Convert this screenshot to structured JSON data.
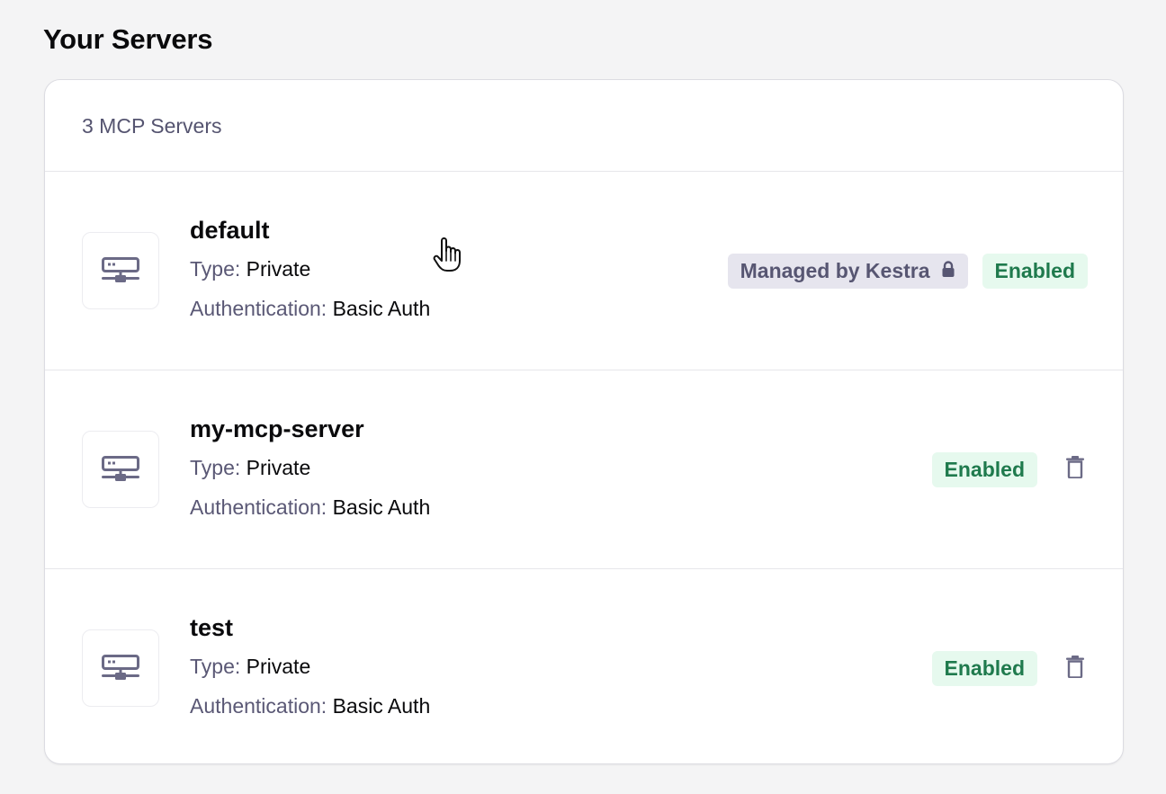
{
  "page": {
    "title": "Your Servers"
  },
  "servers_card": {
    "count_label": "3 MCP Servers"
  },
  "servers": [
    {
      "name": "default",
      "type_label": "Type:",
      "type_value": "Private",
      "auth_label": "Authentication:",
      "auth_value": "Basic Auth",
      "managed_label": "Managed by Kestra",
      "status": "Enabled"
    },
    {
      "name": "my-mcp-server",
      "type_label": "Type:",
      "type_value": "Private",
      "auth_label": "Authentication:",
      "auth_value": "Basic Auth",
      "status": "Enabled"
    },
    {
      "name": "test",
      "type_label": "Type:",
      "type_value": "Private",
      "auth_label": "Authentication:",
      "auth_value": "Basic Auth",
      "status": "Enabled"
    }
  ],
  "icons": {
    "server": "server-icon",
    "lock": "lock-icon",
    "delete": "trash-icon",
    "cursor": "hand-pointer-cursor"
  },
  "colors": {
    "background": "#f4f4f5",
    "card": "#ffffff",
    "muted_text": "#5a5875",
    "icon": "#6b6a86",
    "managed_badge_bg": "#e6e5ee",
    "managed_badge_text": "#575672",
    "enabled_badge_bg": "#e6f9ee",
    "enabled_badge_text": "#1f7a4d"
  }
}
